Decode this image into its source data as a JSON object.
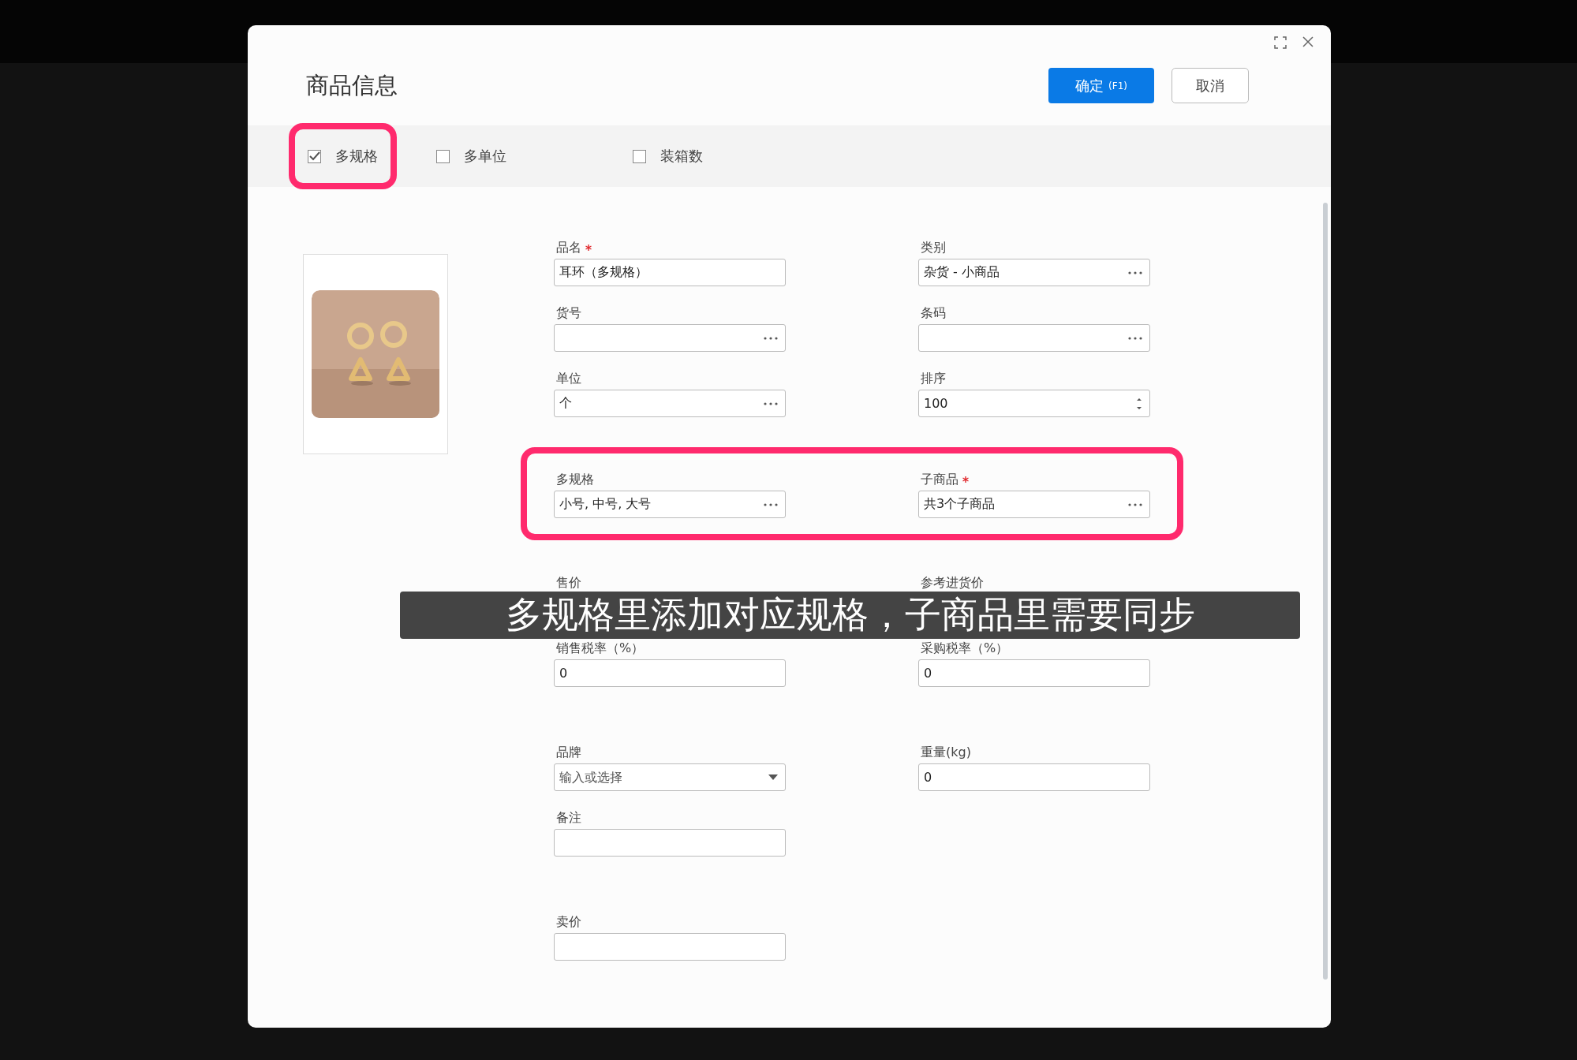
{
  "dialog": {
    "title": "商品信息",
    "confirm_button": "确定",
    "confirm_shortcut": "(F1)",
    "cancel_button": "取消"
  },
  "options": [
    {
      "label": "多规格",
      "checked": true,
      "highlighted": true
    },
    {
      "label": "多单位",
      "checked": false,
      "highlighted": false
    },
    {
      "label": "装箱数",
      "checked": false,
      "highlighted": false
    }
  ],
  "field_groups": [
    {
      "highlighted": false,
      "fields": [
        {
          "label": "品名",
          "required": true,
          "kind": "text",
          "value": "耳环（多规格）"
        },
        {
          "label": "类别",
          "required": false,
          "kind": "picker",
          "value": "杂货 - 小商品"
        },
        {
          "label": "货号",
          "required": false,
          "kind": "picker"
        },
        {
          "label": "条码",
          "required": false,
          "kind": "picker"
        },
        {
          "label": "单位",
          "required": false,
          "kind": "picker",
          "value": "个"
        },
        {
          "label": "排序",
          "required": false,
          "kind": "number",
          "value": "100"
        }
      ]
    },
    {
      "highlighted": true,
      "fields": [
        {
          "label": "多规格",
          "required": false,
          "kind": "picker",
          "value": "小号, 中号, 大号"
        },
        {
          "label": "子商品",
          "required": true,
          "kind": "picker",
          "value": "共3个子商品"
        }
      ]
    },
    {
      "highlighted": false,
      "fields": [
        {
          "label": "售价",
          "required": false,
          "kind": "covered"
        },
        {
          "label": "参考进货价",
          "required": false,
          "kind": "covered"
        },
        {
          "label": "销售税率（%）",
          "required": false,
          "kind": "text",
          "value": "0"
        },
        {
          "label": "采购税率（%）",
          "required": false,
          "kind": "text",
          "value": "0"
        }
      ]
    },
    {
      "highlighted": false,
      "fields": [
        {
          "label": "品牌",
          "required": false,
          "kind": "select",
          "placeholder": "输入或选择"
        },
        {
          "label": "重量(kg)",
          "required": false,
          "kind": "text",
          "value": "0"
        },
        {
          "label": "备注",
          "required": false,
          "kind": "text"
        }
      ]
    },
    {
      "highlighted": false,
      "fields": [
        {
          "label": "卖价",
          "required": false,
          "kind": "text"
        }
      ]
    }
  ],
  "caption": "多规格里添加对应规格，子商品里需要同步"
}
